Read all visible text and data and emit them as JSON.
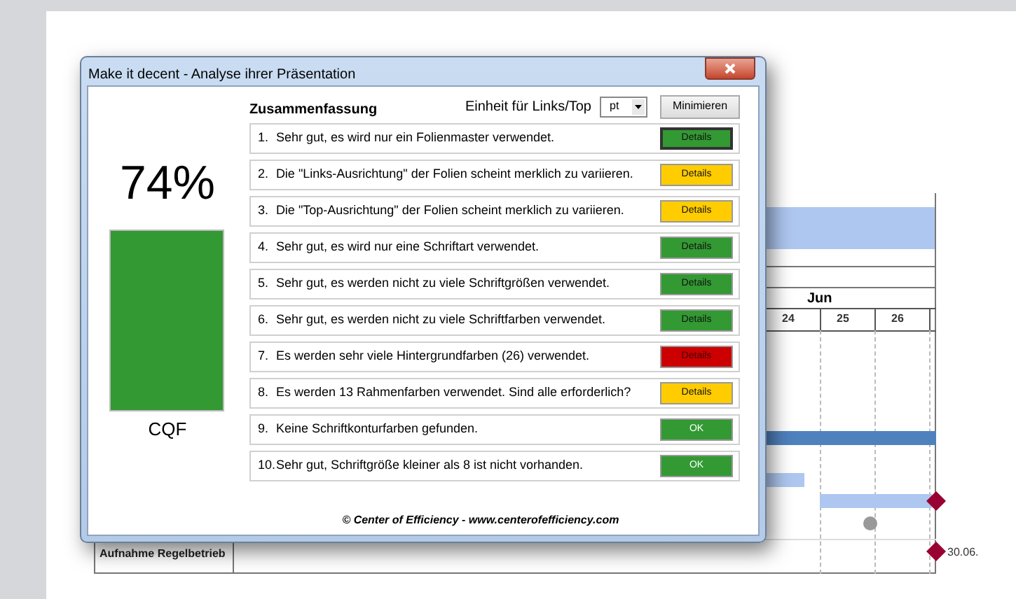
{
  "window": {
    "title": "Make it decent - Analyse ihrer Präsentation"
  },
  "score": {
    "value": "74%",
    "label": "CQF"
  },
  "summary": {
    "title": "Zusammenfassung",
    "unit_label": "Einheit für Links/Top",
    "unit_value": "pt",
    "minimize_button": "Minimieren"
  },
  "checks": [
    {
      "number": "1.",
      "text": "Sehr gut, es wird nur ein Folienmaster verwendet.",
      "button": "Details",
      "color": "#339933",
      "selected": true
    },
    {
      "number": "2.",
      "text": "Die \"Links-Ausrichtung\" der Folien scheint merklich zu variieren.",
      "button": "Details",
      "color": "#ffcc00",
      "selected": false
    },
    {
      "number": "3.",
      "text": "Die \"Top-Ausrichtung\" der Folien scheint merklich zu variieren.",
      "button": "Details",
      "color": "#ffcc00",
      "selected": false
    },
    {
      "number": "4.",
      "text": "Sehr gut, es wird nur eine Schriftart verwendet.",
      "button": "Details",
      "color": "#339933",
      "selected": false
    },
    {
      "number": "5.",
      "text": "Sehr gut, es werden nicht zu viele Schriftgrößen verwendet.",
      "button": "Details",
      "color": "#339933",
      "selected": false
    },
    {
      "number": "6.",
      "text": "Sehr gut, es werden nicht zu viele Schriftfarben verwendet.",
      "button": "Details",
      "color": "#339933",
      "selected": false
    },
    {
      "number": "7.",
      "text": "Es werden sehr viele Hintergrundfarben (26) verwendet.",
      "button": "Details",
      "color": "#cc0000",
      "selected": false
    },
    {
      "number": "8.",
      "text": "Es werden 13 Rahmenfarben verwendet. Sind alle erforderlich?",
      "button": "Details",
      "color": "#ffcc00",
      "selected": false
    },
    {
      "number": "9.",
      "text": "Keine Schriftkonturfarben gefunden.",
      "button": "OK",
      "color": "#339933",
      "selected": false
    },
    {
      "number": "10.",
      "text": "Sehr gut, Schriftgröße kleiner als 8 ist nicht vorhanden.",
      "button": "OK",
      "color": "#339933",
      "selected": false
    }
  ],
  "footer": "© Center of Efficiency - www.centerofefficiency.com",
  "background_slide": {
    "month": "Jun",
    "days": [
      "24",
      "25",
      "26"
    ],
    "milestone_label": "30.06.",
    "row_label": "Aufnahme Regelbetrieb"
  }
}
